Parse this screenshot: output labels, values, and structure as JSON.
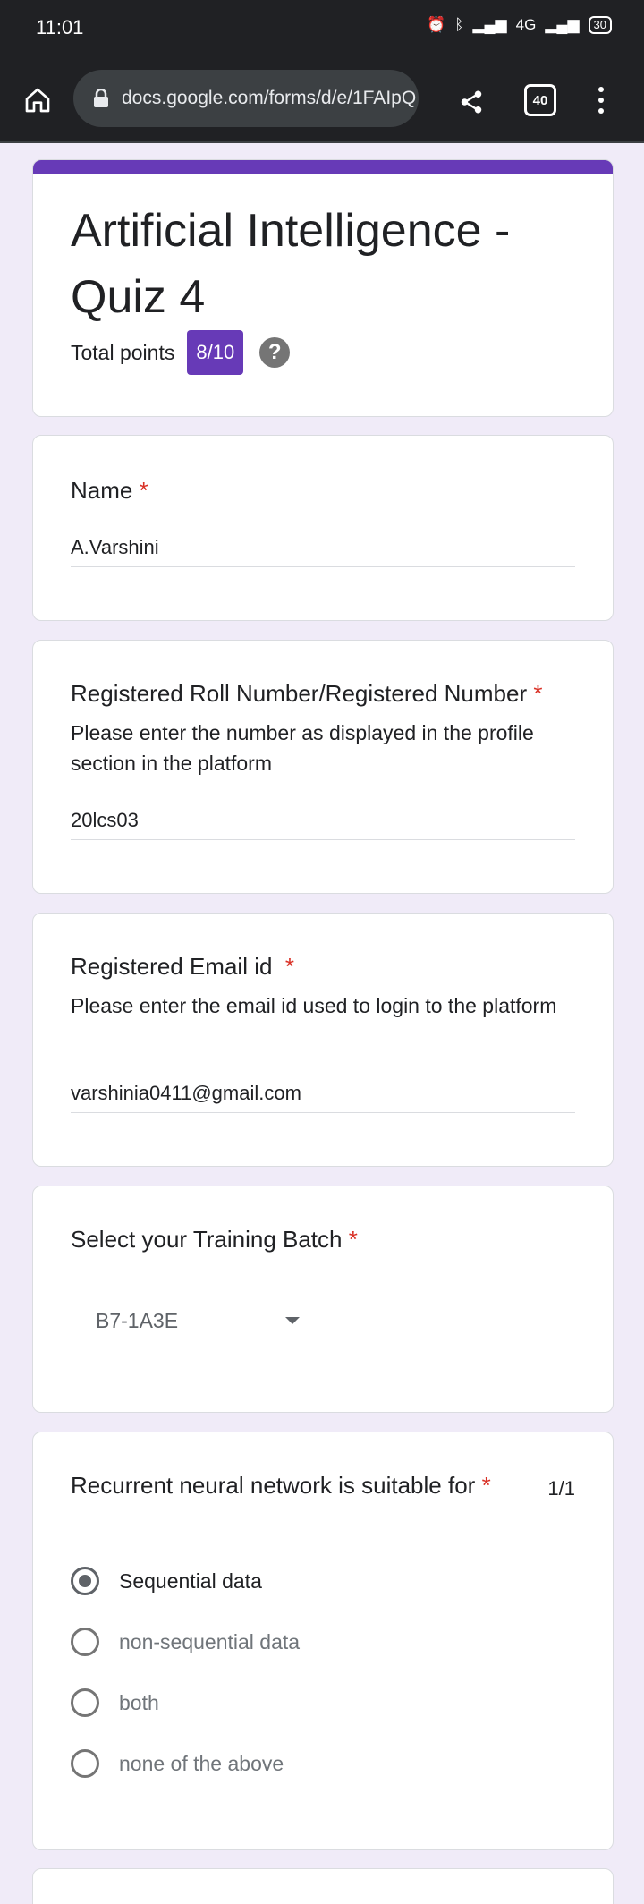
{
  "status": {
    "time": "11:01",
    "battery": "30",
    "network": "4G"
  },
  "browser": {
    "url": "docs.google.com/forms/d/e/1FAIpQ",
    "tab_count": "40"
  },
  "form": {
    "title": "Artificial Intelligence - Quiz 4",
    "points_label": "Total points",
    "points_value": "8/10",
    "help": "?"
  },
  "questions": {
    "name": {
      "title": "Name",
      "required": "*",
      "answer": "A.Varshini"
    },
    "roll": {
      "title": "Registered Roll Number/Registered Number",
      "required": "*",
      "description": "Please enter the number as displayed in the profile section in the platform",
      "answer": "20lcs03"
    },
    "email": {
      "title": "Registered Email id",
      "required": "*",
      "description": "Please enter the email id used to login to the platform",
      "answer": "varshinia0411@gmail.com"
    },
    "batch": {
      "title": "Select your Training Batch",
      "required": "*",
      "selected": "B7-1A3E"
    },
    "rnn": {
      "title": "Recurrent neural network is suitable for",
      "required": "*",
      "score": "1/1",
      "options": [
        "Sequential data",
        "non-sequential data",
        "both",
        "none of the above"
      ],
      "selected_index": 0
    }
  },
  "colors": {
    "accent": "#673ab7",
    "required": "#d93025",
    "background": "#f0ebf8"
  }
}
